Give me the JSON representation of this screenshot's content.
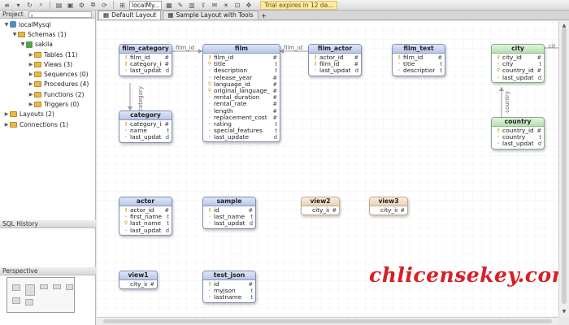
{
  "toolbar": {
    "connection_combo": "localMy...",
    "trial_text": "Trial expires in 12 da..."
  },
  "left_panel": {
    "project_header": "Project",
    "tree": [
      {
        "label": "localMysql",
        "icon": "database-icon",
        "arrow": "▼",
        "indent": 0
      },
      {
        "label": "Schemas (1)",
        "icon": "folder-icon",
        "arrow": "▼",
        "indent": 1
      },
      {
        "label": "sakila",
        "icon": "schema-icon",
        "arrow": "▼",
        "indent": 2
      },
      {
        "label": "Tables (11)",
        "icon": "folder-icon",
        "arrow": "▶",
        "indent": 3
      },
      {
        "label": "Views (3)",
        "icon": "folder-icon",
        "arrow": "▶",
        "indent": 3
      },
      {
        "label": "Sequences (0)",
        "icon": "folder-icon",
        "arrow": "▶",
        "indent": 3
      },
      {
        "label": "Procedures (4)",
        "icon": "folder-icon",
        "arrow": "▶",
        "indent": 3
      },
      {
        "label": "Functions (2)",
        "icon": "folder-icon",
        "arrow": "▶",
        "indent": 3
      },
      {
        "label": "Triggers (0)",
        "icon": "folder-icon",
        "arrow": "▶",
        "indent": 3
      },
      {
        "label": "Layouts (2)",
        "icon": "folder-icon",
        "arrow": "▶",
        "indent": 0
      },
      {
        "label": "Connections (1)",
        "icon": "folder-icon",
        "arrow": "▶",
        "indent": 0
      }
    ],
    "sql_history_header": "SQL History",
    "perspective_header": "Perspective"
  },
  "tabs": [
    {
      "label": "Default Layout",
      "active": true
    },
    {
      "label": "Sample Layout with Tools",
      "active": false
    }
  ],
  "entities": [
    {
      "id": "film_category",
      "title": "film_category",
      "style": "blue",
      "rows": [
        [
          "key",
          "film_id",
          "#"
        ],
        [
          "key",
          "category_id",
          "#"
        ],
        [
          "dot",
          "last_update",
          "d"
        ]
      ]
    },
    {
      "id": "film",
      "title": "film",
      "style": "blue",
      "rows": [
        [
          "key",
          "film_id",
          "#"
        ],
        [
          "idx",
          "title",
          "t"
        ],
        [
          "dot",
          "description",
          "t"
        ],
        [
          "dot",
          "release_year",
          "#"
        ],
        [
          "idx",
          "language_id",
          "#"
        ],
        [
          "idx",
          "original_language_id",
          "#"
        ],
        [
          "dot",
          "rental_duration",
          "#"
        ],
        [
          "dot",
          "rental_rate",
          "#"
        ],
        [
          "dot",
          "length",
          "#"
        ],
        [
          "dot",
          "replacement_cost",
          "#"
        ],
        [
          "dot",
          "rating",
          "t"
        ],
        [
          "dot",
          "special_features",
          "t"
        ],
        [
          "dot",
          "last_update",
          "d"
        ]
      ]
    },
    {
      "id": "film_actor",
      "title": "film_actor",
      "style": "blue",
      "rows": [
        [
          "key",
          "actor_id",
          "#"
        ],
        [
          "key",
          "film_id",
          "#"
        ],
        [
          "dot",
          "last_update",
          "d"
        ]
      ]
    },
    {
      "id": "film_text",
      "title": "film_text",
      "style": "blue",
      "rows": [
        [
          "key",
          "film_id",
          "#"
        ],
        [
          "dot",
          "title",
          "t"
        ],
        [
          "dot",
          "description",
          "t"
        ]
      ]
    },
    {
      "id": "city",
      "title": "city",
      "style": "green",
      "rows": [
        [
          "key",
          "city_id",
          "#"
        ],
        [
          "dot",
          "city",
          "t"
        ],
        [
          "idx",
          "country_id",
          "#"
        ],
        [
          "dot",
          "last_update",
          "d"
        ]
      ]
    },
    {
      "id": "category",
      "title": "category",
      "style": "blue",
      "rows": [
        [
          "key",
          "category_id",
          "#"
        ],
        [
          "dot",
          "name",
          "t"
        ],
        [
          "dot",
          "last_update",
          "d"
        ]
      ]
    },
    {
      "id": "country",
      "title": "country",
      "style": "green",
      "rows": [
        [
          "key",
          "country_id",
          "#"
        ],
        [
          "dot",
          "country",
          "t"
        ],
        [
          "dot",
          "last_update",
          "d"
        ]
      ]
    },
    {
      "id": "actor",
      "title": "actor",
      "style": "blue",
      "rows": [
        [
          "key",
          "actor_id",
          "#"
        ],
        [
          "dot",
          "first_name",
          "t"
        ],
        [
          "idx",
          "last_name",
          "t"
        ],
        [
          "dot",
          "last_update",
          "d"
        ]
      ]
    },
    {
      "id": "sample",
      "title": "sample",
      "style": "blue",
      "rows": [
        [
          "key",
          "id",
          "#"
        ],
        [
          "dot",
          "last_name",
          "t"
        ],
        [
          "dot",
          "last_update",
          "d"
        ]
      ]
    },
    {
      "id": "view2",
      "title": "view2",
      "style": "view",
      "rows": [
        [
          "none",
          "city_id",
          "#"
        ]
      ]
    },
    {
      "id": "view3",
      "title": "view3",
      "style": "view",
      "rows": [
        [
          "none",
          "city_id",
          "#"
        ]
      ]
    },
    {
      "id": "view1",
      "title": "view1",
      "style": "blue",
      "rows": [
        [
          "none",
          "city_id",
          "#"
        ]
      ]
    },
    {
      "id": "test_json",
      "title": "test_json",
      "style": "blue",
      "rows": [
        [
          "key",
          "id",
          "#"
        ],
        [
          "dot",
          "myjson",
          "t"
        ],
        [
          "dot",
          "lastname",
          "t"
        ]
      ]
    }
  ],
  "relations": {
    "film_id_left": "film_id",
    "film_id_right": "film_id",
    "category": "category",
    "country": "country",
    "cit": "cit"
  },
  "watermark": "chlicensekey.com"
}
